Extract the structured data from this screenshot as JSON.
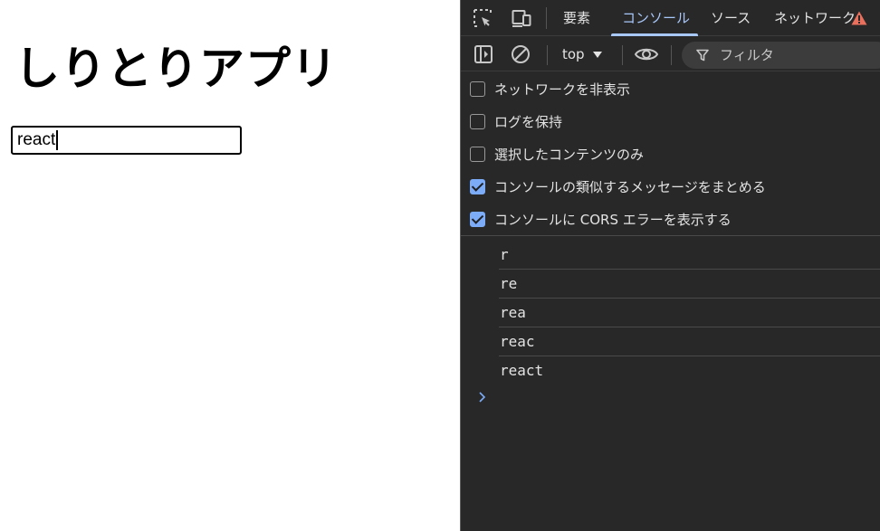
{
  "page": {
    "title": "しりとりアプリ",
    "input_value": "react"
  },
  "devtools": {
    "tabs": [
      {
        "label": "要素"
      },
      {
        "label": "コンソール"
      },
      {
        "label": "ソース"
      },
      {
        "label": "ネットワーク"
      }
    ],
    "toolbar": {
      "context": "top",
      "filter_placeholder": "フィルタ"
    },
    "settings": [
      {
        "label": "ネットワークを非表示",
        "checked": false
      },
      {
        "label": "ログを保持",
        "checked": false
      },
      {
        "label": "選択したコンテンツのみ",
        "checked": false
      },
      {
        "label": "コンソールの類似するメッセージをまとめる",
        "checked": true
      },
      {
        "label": "コンソールに CORS エラーを表示する",
        "checked": true
      }
    ],
    "logs": [
      "r",
      "re",
      "rea",
      "reac",
      "react"
    ],
    "colors": {
      "panel_bg": "#282828",
      "accent": "#a8c7fa",
      "checkbox": "#7cacf8",
      "warning": "#e8705c"
    }
  }
}
